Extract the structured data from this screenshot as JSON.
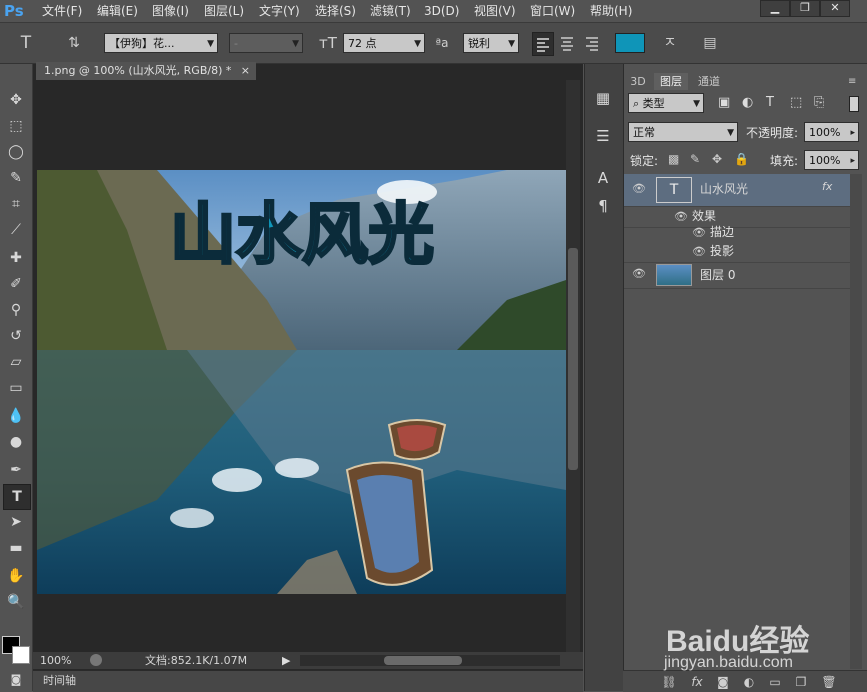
{
  "app": {
    "logo": "Ps"
  },
  "menu": {
    "items": [
      "文件(F)",
      "编辑(E)",
      "图像(I)",
      "图层(L)",
      "文字(Y)",
      "选择(S)",
      "滤镜(T)",
      "3D(D)",
      "视图(V)",
      "窗口(W)",
      "帮助(H)"
    ]
  },
  "window_controls": {
    "minimize": "▁",
    "restore": "❐",
    "close": "✕"
  },
  "options": {
    "font_family": "【伊狗】花...",
    "font_style": "-",
    "font_size": "72 点",
    "aa_label": "ªa",
    "antialias": "锐利",
    "text_color": "#0f95b8"
  },
  "document": {
    "tab_title": "1.png @ 100% (山水风光, RGB/8) *",
    "tab_close": "×",
    "canvas_text": "山水风光",
    "zoom": "100%",
    "doc_info": "文档:852.1K/1.07M"
  },
  "timeline": {
    "label": "时间轴"
  },
  "panels": {
    "tabs": [
      "3D",
      "图层",
      "通道"
    ],
    "filter_kind": "类型",
    "blend_mode": "正常",
    "opacity_label": "不透明度:",
    "opacity_value": "100%",
    "lock_label": "锁定:",
    "fill_label": "填充:",
    "fill_value": "100%",
    "layers": [
      {
        "name": "山水风光",
        "fx": "fx"
      },
      {
        "name": "效果"
      },
      {
        "name": "描边"
      },
      {
        "name": "投影"
      },
      {
        "name": "图层 0"
      }
    ]
  },
  "watermark": {
    "brand": "Baidu经验",
    "url": "jingyan.baidu.com"
  }
}
